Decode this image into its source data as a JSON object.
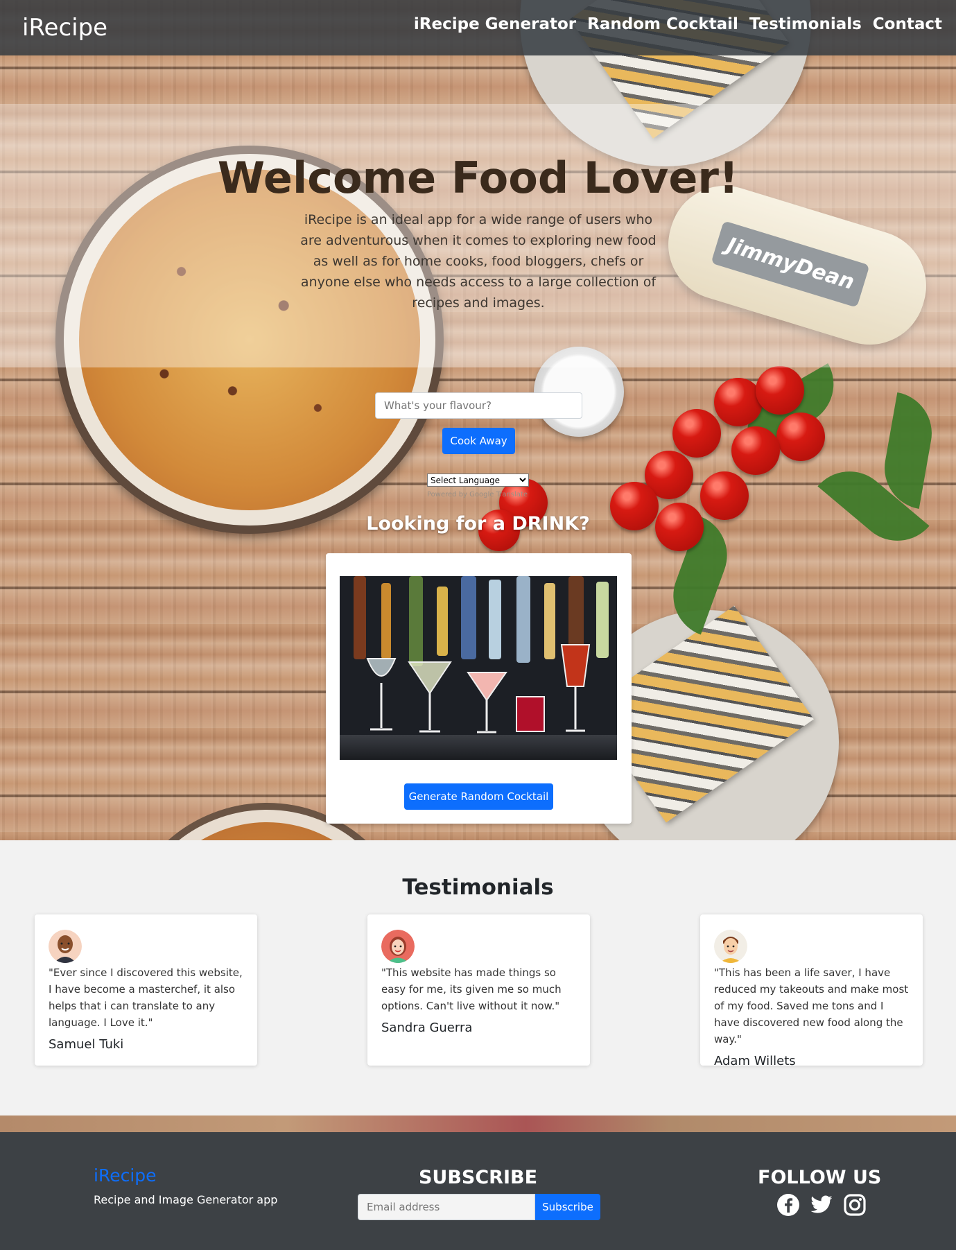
{
  "navbar": {
    "brand": "iRecipe",
    "links": [
      "iRecipe Generator",
      "Random Cocktail",
      "Testimonials",
      "Contact"
    ]
  },
  "hero": {
    "title": "Welcome Food Lover!",
    "text": "iRecipe is an ideal app for a wide range of users who are adventurous when it comes to exploring new food as well as for home cooks, food bloggers, chefs or anyone else who needs access to a large collection of recipes and images.",
    "sausage_label": "JimmyDean",
    "search_placeholder": "What's your flavour?",
    "cook_button": "Cook Away",
    "language_select": "Select Language",
    "powered_by": "Powered by Google Translate"
  },
  "drink": {
    "heading": "Looking for a DRINK?",
    "button": "Generate Random Cocktail"
  },
  "testimonials": {
    "heading": "Testimonials",
    "items": [
      {
        "quote": "\"Ever since I discovered this website, I have become a masterchef, it also helps that i can translate to any language. I Love it.\"",
        "name": "Samuel Tuki"
      },
      {
        "quote": "\"This website has made things so easy for me, its given me so much options. Can't live without it now.\"",
        "name": "Sandra Guerra"
      },
      {
        "quote": "\"This has been a life saver, I have reduced my takeouts and make most of my food. Saved me tons and I have discovered new food along the way.\"",
        "name": "Adam Willets"
      }
    ]
  },
  "footer": {
    "brand": "iRecipe",
    "tagline": "Recipe and Image Generator app",
    "subscribe_title": "SUBSCRIBE",
    "email_placeholder": "Email address",
    "subscribe_button": "Subscribe",
    "follow_title": "FOLLOW US",
    "socials": [
      "facebook-icon",
      "twitter-icon",
      "instagram-icon"
    ]
  },
  "colors": {
    "primary": "#0d6efd",
    "navbar": "#343a40",
    "footer": "#3d4145"
  }
}
